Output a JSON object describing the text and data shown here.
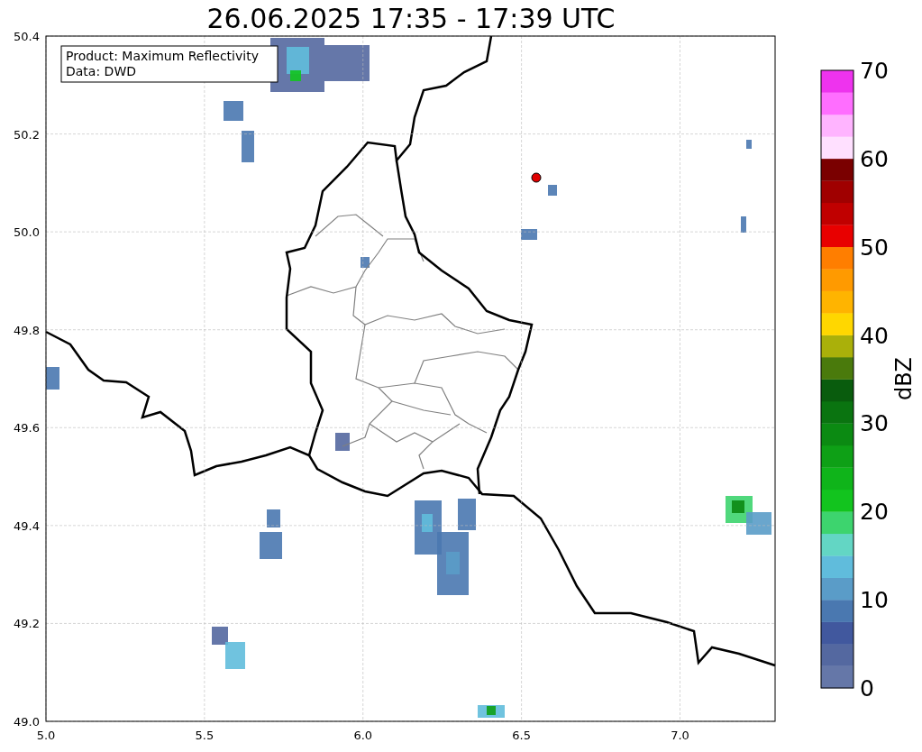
{
  "title": "26.06.2025 17:35 - 17:39 UTC",
  "legend": [
    "Product: Maximum Reflectivity",
    "Data: DWD"
  ],
  "x_ticks": [
    "5.0",
    "5.5",
    "6.0",
    "6.5",
    "7.0"
  ],
  "y_ticks": [
    "50.4",
    "50.2",
    "50.0",
    "49.8",
    "49.6",
    "49.4",
    "49.2",
    "49.0"
  ],
  "colorbar": {
    "label": "dBZ",
    "ticks": [
      "70",
      "60",
      "50",
      "40",
      "30",
      "20",
      "10",
      "0"
    ],
    "bins": [
      {
        "color": "#6577a8"
      },
      {
        "color": "#5468a0"
      },
      {
        "color": "#41589e"
      },
      {
        "color": "#4a78b0"
      },
      {
        "color": "#5a9cc8"
      },
      {
        "color": "#60bcdc"
      },
      {
        "color": "#63d6c4"
      },
      {
        "color": "#3dd46e"
      },
      {
        "color": "#12c41e"
      },
      {
        "color": "#0fb41a"
      },
      {
        "color": "#0ea016"
      },
      {
        "color": "#0b8a12"
      },
      {
        "color": "#0a7410"
      },
      {
        "color": "#095c0d"
      },
      {
        "color": "#4a7a0c"
      },
      {
        "color": "#aab00a"
      },
      {
        "color": "#ffd700"
      },
      {
        "color": "#ffb400"
      },
      {
        "color": "#ff9a00"
      },
      {
        "color": "#ff7e00"
      },
      {
        "color": "#e80000"
      },
      {
        "color": "#c00000"
      },
      {
        "color": "#a00000"
      },
      {
        "color": "#7a0000"
      },
      {
        "color": "#ffe0ff"
      },
      {
        "color": "#ffb4ff"
      },
      {
        "color": "#ff6eff"
      },
      {
        "color": "#ee33ee"
      }
    ]
  }
}
